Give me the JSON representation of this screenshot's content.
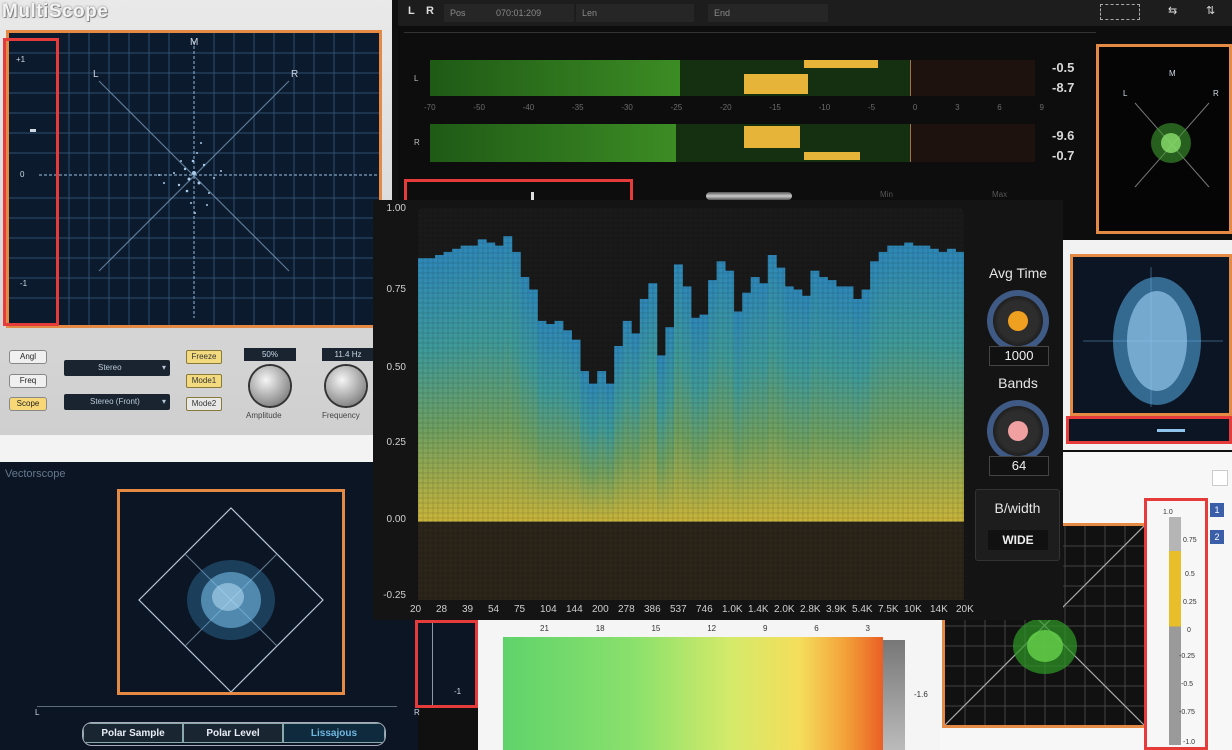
{
  "multiscope": {
    "title": "MultiScope",
    "scope_labels": {
      "m": "M",
      "l": "L",
      "r": "R"
    },
    "scale": [
      "+1",
      "0",
      "-1"
    ],
    "mode_buttons": [
      "Angl",
      "Freq",
      "Scope"
    ],
    "dropdowns": [
      "Stereo",
      "Stereo (Front)"
    ],
    "yellow_buttons": [
      "Freeze",
      "Mode1",
      "Mode2"
    ],
    "amplitude": {
      "value": "50%",
      "label": "Amplitude"
    },
    "frequency": {
      "value": "11.4 Hz",
      "label": "Frequency"
    }
  },
  "vectorscope": {
    "title": "Vectorscope",
    "corner_left": "L",
    "corner_right": "R",
    "buttons": [
      "Polar Sample",
      "Polar Level",
      "Lissajous"
    ]
  },
  "top_meter": {
    "toolbar": {
      "l": "L",
      "r": "R",
      "pos": "Pos",
      "time": "070:01:209",
      "len": "Len",
      "end": "End"
    },
    "channels": [
      "L",
      "R"
    ],
    "scale": [
      "-70",
      "-50",
      "-40",
      "-35",
      "-30",
      "-25",
      "-20",
      "-15",
      "-10",
      "-5",
      "0",
      "3",
      "6",
      "9"
    ],
    "peaks_l": [
      "-0.5",
      "-8.7"
    ],
    "peaks_r": [
      "-9.6",
      "-0.7"
    ],
    "level_l": 0.78,
    "level_r": 0.77,
    "footer": [
      "Min",
      "Max"
    ],
    "vec_labels": {
      "m": "M",
      "l": "L",
      "r": "R"
    }
  },
  "spectrum": {
    "controls": {
      "avg_time_label": "Avg Time",
      "avg_time_value": "1000",
      "bands_label": "Bands",
      "bands_value": "64",
      "bwidth_label": "B/width",
      "bwidth_value": "WIDE"
    },
    "colors": {
      "knob_avg": "#f0a020",
      "knob_bands": "#f0a0a0",
      "ring": "#3f5a85"
    }
  },
  "bottom_meter": {
    "ticks": [
      "21",
      "18",
      "15",
      "12",
      "9",
      "6",
      "3"
    ],
    "right_value": "-1.6",
    "side_value": "-1"
  },
  "right_meter": {
    "ticks": [
      "1.0",
      "0.75",
      "0.5",
      "0.25",
      "0",
      "-0.25",
      "-0.5",
      "-0.75",
      "-1.0"
    ],
    "badges": [
      "1",
      "2"
    ]
  },
  "chart_data": {
    "type": "bar",
    "ylim": [
      -0.25,
      1.0
    ],
    "yticks": [
      "1.00",
      "0.75",
      "0.50",
      "0.25",
      "0.00",
      "-0.25"
    ],
    "xticks": [
      "20",
      "28",
      "39",
      "54",
      "75",
      "104",
      "144",
      "200",
      "278",
      "386",
      "537",
      "746",
      "1.0K",
      "1.4K",
      "2.0K",
      "2.8K",
      "3.9K",
      "5.4K",
      "7.5K",
      "10K",
      "14K",
      "20K"
    ],
    "values": [
      0.84,
      0.84,
      0.85,
      0.86,
      0.87,
      0.88,
      0.88,
      0.9,
      0.89,
      0.88,
      0.91,
      0.86,
      0.78,
      0.74,
      0.64,
      0.63,
      0.64,
      0.61,
      0.58,
      0.48,
      0.44,
      0.48,
      0.44,
      0.56,
      0.64,
      0.6,
      0.71,
      0.76,
      0.53,
      0.62,
      0.82,
      0.75,
      0.65,
      0.66,
      0.77,
      0.83,
      0.8,
      0.67,
      0.73,
      0.78,
      0.76,
      0.85,
      0.81,
      0.75,
      0.74,
      0.72,
      0.8,
      0.78,
      0.77,
      0.75,
      0.75,
      0.71,
      0.74,
      0.83,
      0.86,
      0.88,
      0.88,
      0.89,
      0.88,
      0.88,
      0.87,
      0.86,
      0.87,
      0.86
    ]
  }
}
